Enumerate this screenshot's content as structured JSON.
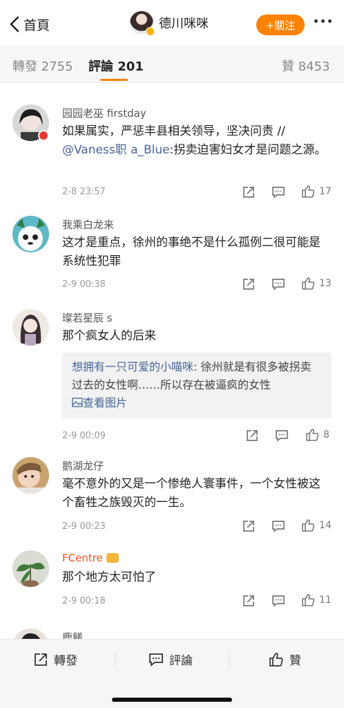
{
  "header": {
    "back_label": "首頁",
    "author_name": "德川咪咪",
    "follow_label": "+關注"
  },
  "tabs": {
    "repost": "轉發 2755",
    "comments": "評論 201",
    "likes": "贊 8453"
  },
  "colors": {
    "accent": "#ff8200",
    "link": "#46669a"
  },
  "comments": [
    {
      "name": "园园老巫 firstday",
      "text": "如果属实，严惩丰县相关领导，坚决问责 //",
      "mention": "@Vaness职 a_Blue",
      "text_after_mention": ":拐卖迫害妇女才是问题之源。",
      "time": "2-8 23:57",
      "likes": "17"
    },
    {
      "name": "我乘白龙来",
      "text": "这才是重点，徐州的事绝不是什么孤例二很可能是系统性犯罪",
      "time": "2-9 00:38",
      "likes": "13"
    },
    {
      "name": "璨若星辰 s",
      "text": "那个疯女人的后来",
      "quote_user": "想拥有一只可爱的小喵咪",
      "quote_text": ": 徐州就是有很多被拐卖过去的女性啊……所以存在被逼疯的女性",
      "quote_link": "查看图片",
      "time": "2-9 00:09",
      "likes": "8"
    },
    {
      "name": "鹅湖龙仔",
      "text": "毫不意外的又是一个惨绝人寰事件，一个女性被这个畜牲之族毁灭的一生。",
      "time": "2-9 00:23",
      "likes": "14"
    },
    {
      "name": "FCentre",
      "text": "那个地方太可怕了",
      "time": "2-9 00:18",
      "likes": "11"
    },
    {
      "name": "鹿饈"
    }
  ],
  "bottom_bar": {
    "repost": "轉發",
    "comment": "評論",
    "like": "贊"
  }
}
